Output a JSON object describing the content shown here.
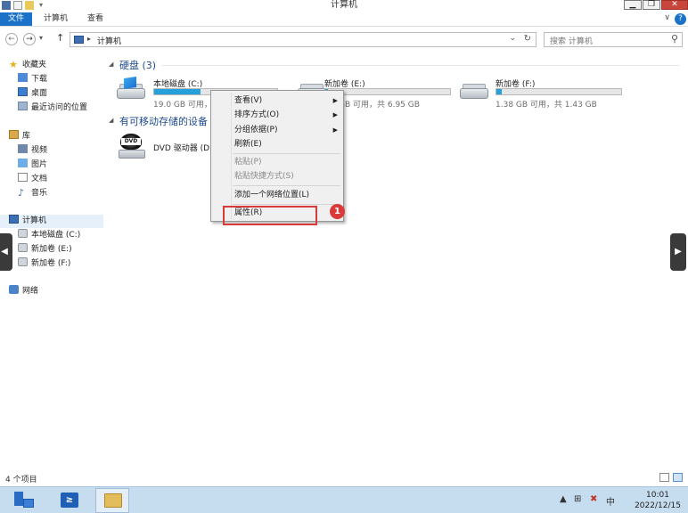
{
  "window": {
    "title": "计算机",
    "controls": {
      "minimize": "▁",
      "maximize": "❐",
      "close": "✕"
    }
  },
  "ribbon": {
    "tabs": [
      "文件",
      "计算机",
      "查看"
    ],
    "help": "?",
    "expand": "∨"
  },
  "address": {
    "separator": "▸",
    "location": "计算机",
    "search_placeholder": "搜索 计算机"
  },
  "nav": {
    "favorites": "收藏夹",
    "downloads": "下载",
    "desktop": "桌面",
    "recent": "最近访问的位置",
    "libraries": "库",
    "videos": "视频",
    "pictures": "图片",
    "documents": "文档",
    "music": "音乐",
    "computer": "计算机",
    "local_c": "本地磁盘 (C:)",
    "vol_e": "新加卷 (E:)",
    "vol_f": "新加卷 (F:)",
    "network": "网络"
  },
  "content": {
    "group_hdd": "硬盘 (3)",
    "group_removable": "有可移动存储的设备",
    "drives": [
      {
        "name": "本地磁盘 (C:)",
        "info": "19.0 GB 可用，",
        "used_fraction": 0.38
      },
      {
        "name": "新加卷 (E:)",
        "info": "GB 可用，共 6.95 GB",
        "used_fraction": 0.02
      },
      {
        "name": "新加卷 (F:)",
        "info": "1.38 GB 可用，共 1.43 GB",
        "used_fraction": 0.04
      }
    ],
    "dvd": {
      "name": "DVD 驱动器 (D:",
      "label": "DVD"
    }
  },
  "context_menu": {
    "view": "查看(V)",
    "sort": "排序方式(O)",
    "group": "分组依据(P)",
    "refresh": "刷新(E)",
    "paste": "粘贴(P)",
    "paste_shortcut": "粘贴快捷方式(S)",
    "add_network": "添加一个网络位置(L)",
    "properties": "属性(R)",
    "submenu_arrow": "▶"
  },
  "annotation": {
    "badge": "1",
    "color": "#d83b3b"
  },
  "status": {
    "items": "4 个项目"
  },
  "taskbar": {
    "powershell": "≥",
    "clock_time": "10:01",
    "clock_date": "2022/12/15",
    "ime": "中",
    "tray_up": "▲"
  },
  "colors": {
    "accent": "#1a73c8",
    "drive_fill": "#26a0da"
  }
}
